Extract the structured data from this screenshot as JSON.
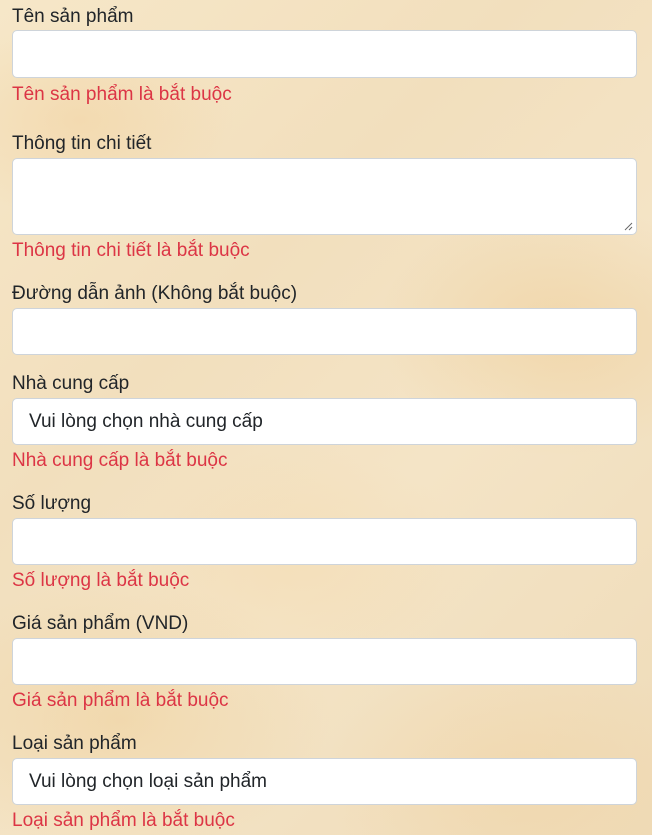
{
  "form": {
    "name": {
      "label": "Tên sản phẩm",
      "value": "",
      "error": "Tên sản phẩm là bắt buộc"
    },
    "details": {
      "label": "Thông tin chi tiết",
      "value": "",
      "error": "Thông tin chi tiết là bắt buộc"
    },
    "image_url": {
      "label": "Đường dẫn ảnh (Không bắt buộc)",
      "value": ""
    },
    "supplier": {
      "label": "Nhà cung cấp",
      "selected": "Vui lòng chọn nhà cung cấp",
      "error": "Nhà cung cấp là bắt buộc"
    },
    "quantity": {
      "label": "Số lượng",
      "value": "",
      "error": "Số lượng là bắt buộc"
    },
    "price": {
      "label": "Giá sản phẩm (VND)",
      "value": "",
      "error": "Giá sản phẩm là bắt buộc"
    },
    "category": {
      "label": "Loại sản phẩm",
      "selected": "Vui lòng chọn loại sản phẩm",
      "error": "Loại sản phẩm là bắt buộc"
    }
  },
  "colors": {
    "error": "#dc3545",
    "border": "#ced4da",
    "text": "#212529"
  }
}
